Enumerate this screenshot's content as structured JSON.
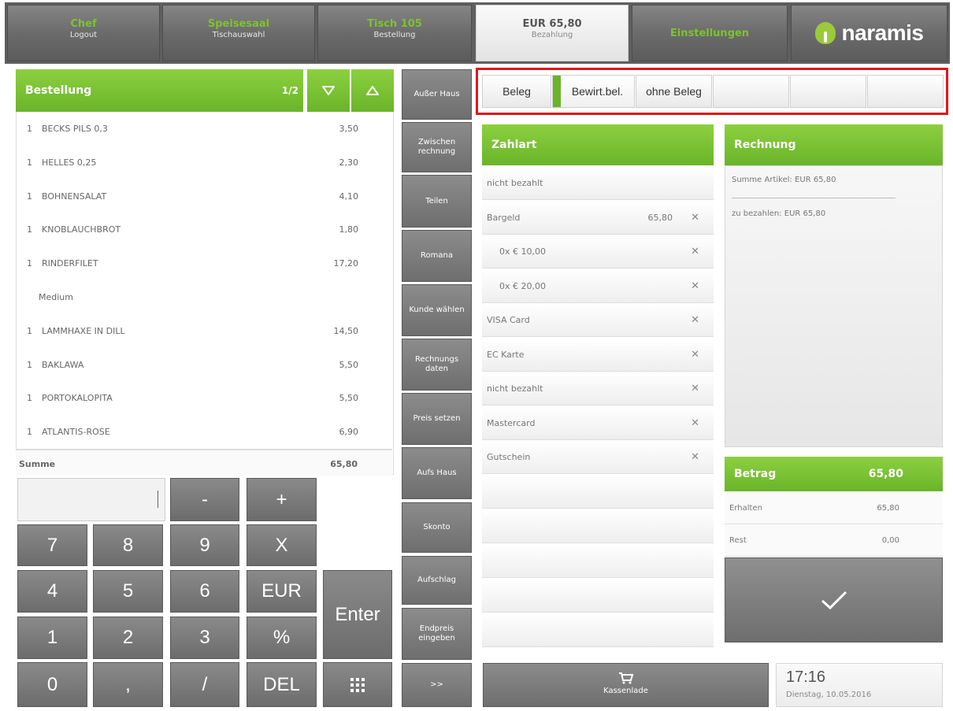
{
  "nav": {
    "chef": {
      "title": "Chef",
      "sub": "Logout"
    },
    "speisesaal": {
      "title": "Speisesaal",
      "sub": "Tischauswahl"
    },
    "tisch": {
      "title": "Tisch 105",
      "sub": "Bestellung"
    },
    "bezahlung": {
      "title": "EUR 65,80",
      "sub": "Bezahlung"
    },
    "einstellungen": {
      "title": "Einstellungen"
    },
    "logo": "naramis"
  },
  "colors": {
    "accent_green": "#6ab42a",
    "highlight_red": "#e3141b",
    "dark_button": "#6e6e6e"
  },
  "order": {
    "title": "Bestellung",
    "page": "1/2",
    "scroll_down_icon": "triangle-down-icon",
    "scroll_up_icon": "triangle-up-icon",
    "items": [
      {
        "qty": "1",
        "name": "BECKS PILS 0,3",
        "price": "3,50"
      },
      {
        "qty": "1",
        "name": "HELLES 0,25",
        "price": "2,30"
      },
      {
        "qty": "1",
        "name": "BOHNENSALAT",
        "price": "4,10"
      },
      {
        "qty": "1",
        "name": "KNOBLAUCHBROT",
        "price": "1,80"
      },
      {
        "qty": "1",
        "name": "RINDERFILET",
        "price": "17,20"
      },
      {
        "qty": "",
        "name": "Medium",
        "price": ""
      },
      {
        "qty": "1",
        "name": "LAMMHAXE IN DILL",
        "price": "14,50"
      },
      {
        "qty": "1",
        "name": "BAKLAWA",
        "price": "5,50"
      },
      {
        "qty": "1",
        "name": "PORTOKALOPITA",
        "price": "5,50"
      },
      {
        "qty": "1",
        "name": "ATLANTIS-ROSE",
        "price": "6,90"
      }
    ],
    "sum_label": "Summe",
    "sum_value": "65,80"
  },
  "keypad": {
    "minus": "-",
    "plus": "+",
    "k7": "7",
    "k8": "8",
    "k9": "9",
    "kx": "X",
    "k4": "4",
    "k5": "5",
    "k6": "6",
    "keur": "EUR",
    "k1": "1",
    "k2": "2",
    "k3": "3",
    "kpct": "%",
    "k0": "0",
    "kcomma": ",",
    "kslash": "/",
    "kdel": "DEL",
    "enter": "Enter",
    "grid_icon": "grid-icon"
  },
  "middle": {
    "buttons": [
      "Außer Haus",
      "Zwischen rechnung",
      "Teilen",
      "Romana",
      "Kunde wählen",
      "Rechnungs daten",
      "Preis setzen",
      "Aufs Haus",
      "Skonto",
      "Aufschlag",
      "Endpreis eingeben",
      ">>"
    ]
  },
  "receipt": {
    "beleg": "Beleg",
    "bewirt": "Bewirt.bel.",
    "ohne": "ohne Beleg"
  },
  "zahlart": {
    "title": "Zahlart",
    "rows": [
      {
        "label": "nicht bezahlt",
        "amount": "",
        "x": ""
      },
      {
        "label": "Bargeld",
        "amount": "65,80",
        "x": "✕"
      },
      {
        "label": "0x      € 10,00",
        "amount": "",
        "x": "✕"
      },
      {
        "label": "0x      € 20,00",
        "amount": "",
        "x": "✕"
      },
      {
        "label": "VISA Card",
        "amount": "",
        "x": "✕"
      },
      {
        "label": "EC Karte",
        "amount": "",
        "x": "✕"
      },
      {
        "label": "nicht bezahlt",
        "amount": "",
        "x": "✕"
      },
      {
        "label": "Mastercard",
        "amount": "",
        "x": "✕"
      },
      {
        "label": "Gutschein",
        "amount": "",
        "x": "✕"
      }
    ]
  },
  "rechnung": {
    "title": "Rechnung",
    "summe_artikel": "Summe Artikel: EUR 65,80",
    "zu_bezahlen": "zu bezahlen: EUR 65,80"
  },
  "betrag": {
    "title": "Betrag",
    "value": "65,80",
    "erhalten_label": "Erhalten",
    "erhalten_value": "65,80",
    "rest_label": "Rest",
    "rest_value": "0,00",
    "confirm_icon": "checkmark-icon"
  },
  "footer": {
    "kasse_icon": "cart-icon",
    "kasse_label": "Kassenlade",
    "time": "17:16",
    "date": "Dienstag, 10.05.2016"
  }
}
